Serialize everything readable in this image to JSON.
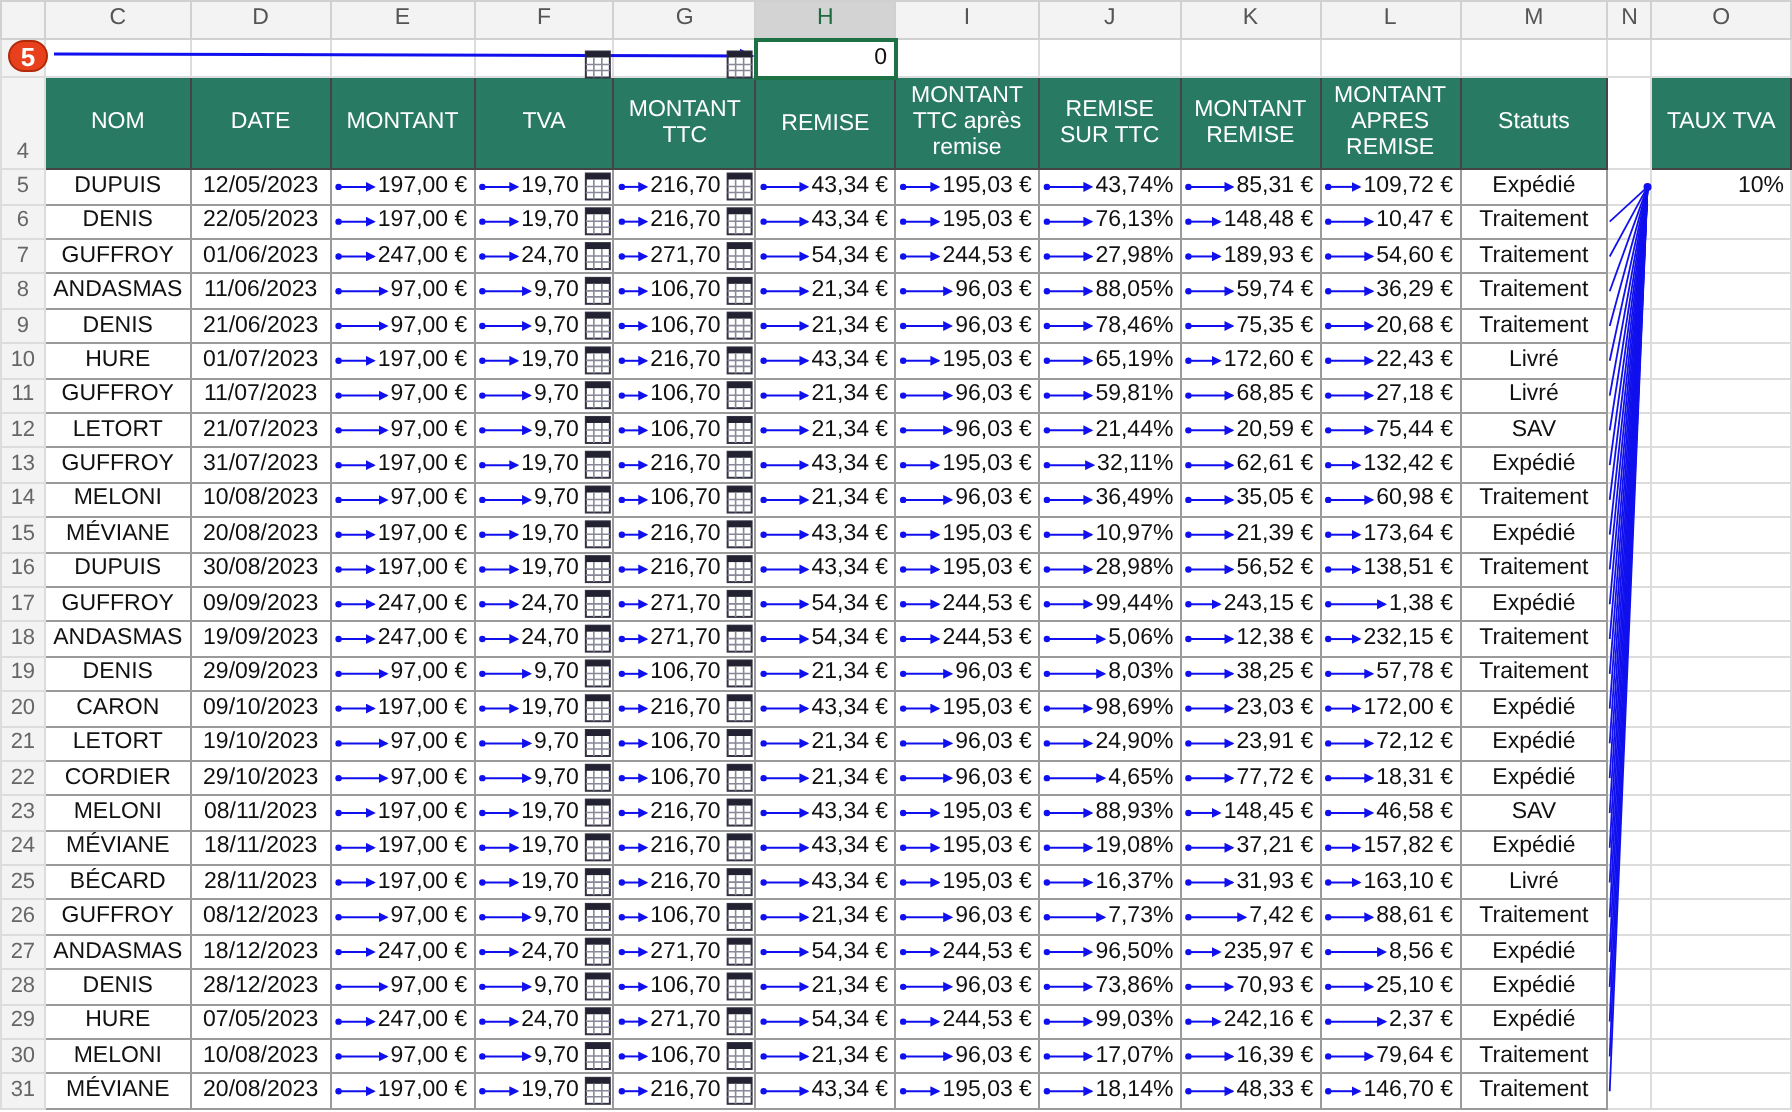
{
  "badge": "5",
  "column_letters": [
    {
      "label": "C",
      "selected": false
    },
    {
      "label": "D",
      "selected": false
    },
    {
      "label": "E",
      "selected": false
    },
    {
      "label": "F",
      "selected": false
    },
    {
      "label": "G",
      "selected": false
    },
    {
      "label": "H",
      "selected": true
    },
    {
      "label": "I",
      "selected": false
    },
    {
      "label": "J",
      "selected": false
    },
    {
      "label": "K",
      "selected": false
    },
    {
      "label": "L",
      "selected": false
    },
    {
      "label": "M",
      "selected": false
    },
    {
      "label": "N",
      "selected": false
    },
    {
      "label": "O",
      "selected": false
    }
  ],
  "cell_h3": "0",
  "header_row_number": "4",
  "headers": [
    "NOM",
    "DATE",
    "MONTANT",
    "TVA",
    "MONTANT TTC",
    "REMISE",
    "MONTANT TTC après remise",
    "REMISE SUR TTC",
    "MONTANT REMISE",
    "MONTANT APRES REMISE",
    "Statuts"
  ],
  "tax_rate_header": "TAUX TVA",
  "tax_rate": "10%",
  "rows": [
    {
      "number": "5",
      "cells": [
        "DUPUIS",
        "12/05/2023",
        "197,00 €",
        "19,70",
        "216,70",
        "43,34 €",
        "195,03 €",
        "43,74%",
        "85,31 €",
        "109,72 €",
        "Expédié"
      ]
    },
    {
      "number": "6",
      "cells": [
        "DENIS",
        "22/05/2023",
        "197,00 €",
        "19,70",
        "216,70",
        "43,34 €",
        "195,03 €",
        "76,13%",
        "148,48 €",
        "10,47 €",
        "Traitement"
      ]
    },
    {
      "number": "7",
      "cells": [
        "GUFFROY",
        "01/06/2023",
        "247,00 €",
        "24,70",
        "271,70",
        "54,34 €",
        "244,53 €",
        "27,98%",
        "189,93 €",
        "54,60 €",
        "Traitement"
      ]
    },
    {
      "number": "8",
      "cells": [
        "ANDASMAS",
        "11/06/2023",
        "97,00 €",
        "9,70",
        "106,70",
        "21,34 €",
        "96,03 €",
        "88,05%",
        "59,74 €",
        "36,29 €",
        "Traitement"
      ]
    },
    {
      "number": "9",
      "cells": [
        "DENIS",
        "21/06/2023",
        "97,00 €",
        "9,70",
        "106,70",
        "21,34 €",
        "96,03 €",
        "78,46%",
        "75,35 €",
        "20,68 €",
        "Traitement"
      ]
    },
    {
      "number": "10",
      "cells": [
        "HURE",
        "01/07/2023",
        "197,00 €",
        "19,70",
        "216,70",
        "43,34 €",
        "195,03 €",
        "65,19%",
        "172,60 €",
        "22,43 €",
        "Livré"
      ]
    },
    {
      "number": "11",
      "cells": [
        "GUFFROY",
        "11/07/2023",
        "97,00 €",
        "9,70",
        "106,70",
        "21,34 €",
        "96,03 €",
        "59,81%",
        "68,85 €",
        "27,18 €",
        "Livré"
      ]
    },
    {
      "number": "12",
      "cells": [
        "LETORT",
        "21/07/2023",
        "97,00 €",
        "9,70",
        "106,70",
        "21,34 €",
        "96,03 €",
        "21,44%",
        "20,59 €",
        "75,44 €",
        "SAV"
      ]
    },
    {
      "number": "13",
      "cells": [
        "GUFFROY",
        "31/07/2023",
        "197,00 €",
        "19,70",
        "216,70",
        "43,34 €",
        "195,03 €",
        "32,11%",
        "62,61 €",
        "132,42 €",
        "Expédié"
      ]
    },
    {
      "number": "14",
      "cells": [
        "MELONI",
        "10/08/2023",
        "97,00 €",
        "9,70",
        "106,70",
        "21,34 €",
        "96,03 €",
        "36,49%",
        "35,05 €",
        "60,98 €",
        "Traitement"
      ]
    },
    {
      "number": "15",
      "cells": [
        "MÉVIANE",
        "20/08/2023",
        "197,00 €",
        "19,70",
        "216,70",
        "43,34 €",
        "195,03 €",
        "10,97%",
        "21,39 €",
        "173,64 €",
        "Expédié"
      ]
    },
    {
      "number": "16",
      "cells": [
        "DUPUIS",
        "30/08/2023",
        "197,00 €",
        "19,70",
        "216,70",
        "43,34 €",
        "195,03 €",
        "28,98%",
        "56,52 €",
        "138,51 €",
        "Traitement"
      ]
    },
    {
      "number": "17",
      "cells": [
        "GUFFROY",
        "09/09/2023",
        "247,00 €",
        "24,70",
        "271,70",
        "54,34 €",
        "244,53 €",
        "99,44%",
        "243,15 €",
        "1,38 €",
        "Expédié"
      ]
    },
    {
      "number": "18",
      "cells": [
        "ANDASMAS",
        "19/09/2023",
        "247,00 €",
        "24,70",
        "271,70",
        "54,34 €",
        "244,53 €",
        "5,06%",
        "12,38 €",
        "232,15 €",
        "Traitement"
      ]
    },
    {
      "number": "19",
      "cells": [
        "DENIS",
        "29/09/2023",
        "97,00 €",
        "9,70",
        "106,70",
        "21,34 €",
        "96,03 €",
        "8,03%",
        "38,25 €",
        "57,78 €",
        "Traitement"
      ]
    },
    {
      "number": "20",
      "cells": [
        "CARON",
        "09/10/2023",
        "197,00 €",
        "19,70",
        "216,70",
        "43,34 €",
        "195,03 €",
        "98,69%",
        "23,03 €",
        "172,00 €",
        "Expédié"
      ]
    },
    {
      "number": "21",
      "cells": [
        "LETORT",
        "19/10/2023",
        "97,00 €",
        "9,70",
        "106,70",
        "21,34 €",
        "96,03 €",
        "24,90%",
        "23,91 €",
        "72,12 €",
        "Expédié"
      ]
    },
    {
      "number": "22",
      "cells": [
        "CORDIER",
        "29/10/2023",
        "97,00 €",
        "9,70",
        "106,70",
        "21,34 €",
        "96,03 €",
        "4,65%",
        "77,72 €",
        "18,31 €",
        "Expédié"
      ]
    },
    {
      "number": "23",
      "cells": [
        "MELONI",
        "08/11/2023",
        "197,00 €",
        "19,70",
        "216,70",
        "43,34 €",
        "195,03 €",
        "88,93%",
        "148,45 €",
        "46,58 €",
        "SAV"
      ]
    },
    {
      "number": "24",
      "cells": [
        "MÉVIANE",
        "18/11/2023",
        "197,00 €",
        "19,70",
        "216,70",
        "43,34 €",
        "195,03 €",
        "19,08%",
        "37,21 €",
        "157,82 €",
        "Expédié"
      ]
    },
    {
      "number": "25",
      "cells": [
        "BÉCARD",
        "28/11/2023",
        "197,00 €",
        "19,70",
        "216,70",
        "43,34 €",
        "195,03 €",
        "16,37%",
        "31,93 €",
        "163,10 €",
        "Livré"
      ]
    },
    {
      "number": "26",
      "cells": [
        "GUFFROY",
        "08/12/2023",
        "97,00 €",
        "9,70",
        "106,70",
        "21,34 €",
        "96,03 €",
        "7,73%",
        "7,42 €",
        "88,61 €",
        "Traitement"
      ]
    },
    {
      "number": "27",
      "cells": [
        "ANDASMAS",
        "18/12/2023",
        "247,00 €",
        "24,70",
        "271,70",
        "54,34 €",
        "244,53 €",
        "96,50%",
        "235,97 €",
        "8,56 €",
        "Expédié"
      ]
    },
    {
      "number": "28",
      "cells": [
        "DENIS",
        "28/12/2023",
        "97,00 €",
        "9,70",
        "106,70",
        "21,34 €",
        "96,03 €",
        "73,86%",
        "70,93 €",
        "25,10 €",
        "Expédié"
      ]
    },
    {
      "number": "29",
      "cells": [
        "HURE",
        "07/05/2023",
        "247,00 €",
        "24,70",
        "271,70",
        "54,34 €",
        "244,53 €",
        "99,03%",
        "242,16 €",
        "2,37 €",
        "Expédié"
      ]
    },
    {
      "number": "30",
      "cells": [
        "MELONI",
        "10/08/2023",
        "97,00 €",
        "9,70",
        "106,70",
        "21,34 €",
        "96,03 €",
        "17,07%",
        "16,39 €",
        "79,64 €",
        "Traitement"
      ]
    },
    {
      "number": "31",
      "cells": [
        "MÉVIANE",
        "20/08/2023",
        "197,00 €",
        "19,70",
        "216,70",
        "43,34 €",
        "195,03 €",
        "18,14%",
        "48,33 €",
        "146,70 €",
        "Traitement"
      ]
    }
  ]
}
